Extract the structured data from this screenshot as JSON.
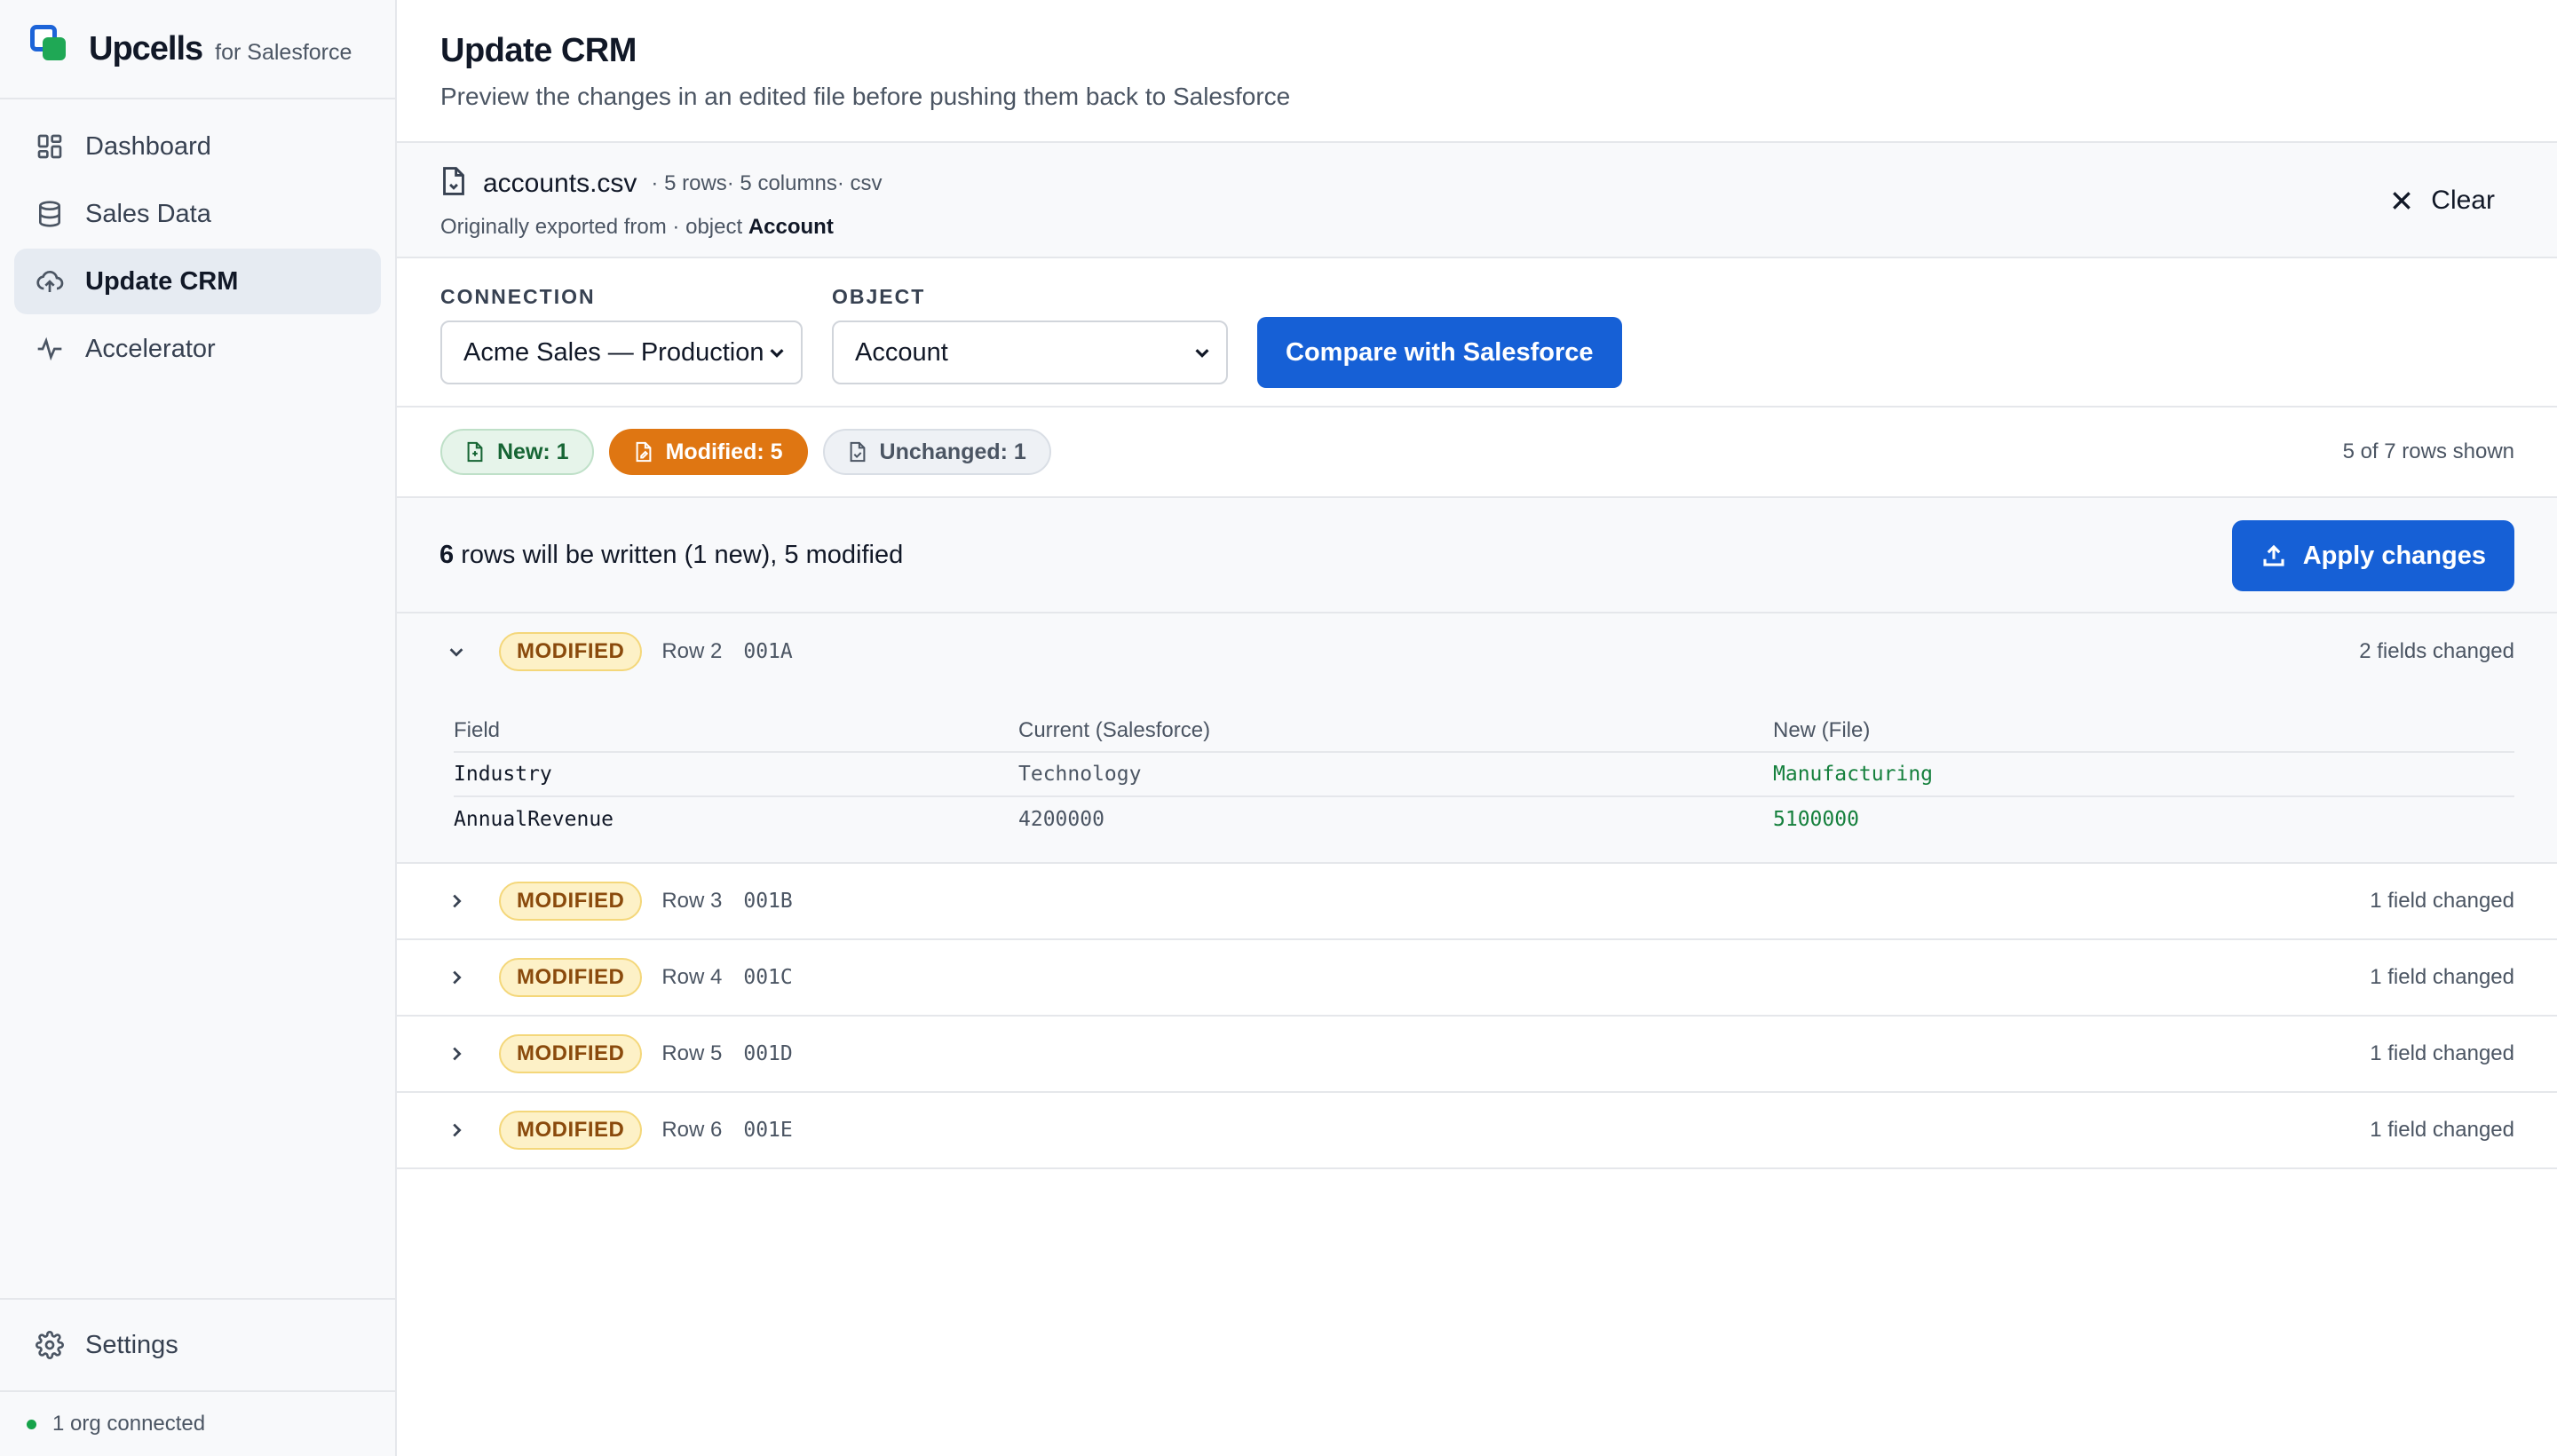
{
  "brand": {
    "name": "Upcells",
    "sub": "for Salesforce"
  },
  "sidebar": {
    "items": [
      {
        "label": "Dashboard",
        "icon": "grid-icon"
      },
      {
        "label": "Sales Data",
        "icon": "database-icon"
      },
      {
        "label": "Update CRM",
        "icon": "cloud-upload-icon",
        "active": true
      },
      {
        "label": "Accelerator",
        "icon": "activity-icon"
      }
    ],
    "settings_label": "Settings",
    "org_status": "1 org connected"
  },
  "header": {
    "title": "Update CRM",
    "subtitle": "Preview the changes in an edited file before pushing them back to Salesforce"
  },
  "file": {
    "name": "accounts.csv",
    "meta": "· 5 rows· 5 columns· csv",
    "origin_prefix": "Originally exported from · object",
    "origin_object": "Account",
    "clear_label": "Clear"
  },
  "selectors": {
    "connection_label": "CONNECTION",
    "connection_value": "Acme Sales — Production",
    "object_label": "OBJECT",
    "object_value": "Account",
    "compare_label": "Compare with Salesforce"
  },
  "filters": {
    "new": "New: 1",
    "modified": "Modified: 5",
    "unchanged": "Unchanged: 1",
    "rows_shown": "5 of 7 rows shown"
  },
  "summary": {
    "count": "6",
    "text": "rows will be written (1 new), 5 modified",
    "apply_label": "Apply changes"
  },
  "diff_headers": {
    "field": "Field",
    "current": "Current (Salesforce)",
    "new": "New (File)"
  },
  "rows": [
    {
      "badge": "MODIFIED",
      "row": "Row 2",
      "id": "001A",
      "changed": "2 fields changed",
      "expanded": true,
      "changes": [
        {
          "field": "Industry",
          "current": "Technology",
          "new": "Manufacturing"
        },
        {
          "field": "AnnualRevenue",
          "current": "4200000",
          "new": "5100000"
        }
      ]
    },
    {
      "badge": "MODIFIED",
      "row": "Row 3",
      "id": "001B",
      "changed": "1 field changed"
    },
    {
      "badge": "MODIFIED",
      "row": "Row 4",
      "id": "001C",
      "changed": "1 field changed"
    },
    {
      "badge": "MODIFIED",
      "row": "Row 5",
      "id": "001D",
      "changed": "1 field changed"
    },
    {
      "badge": "MODIFIED",
      "row": "Row 6",
      "id": "001E",
      "changed": "1 field changed"
    }
  ],
  "colors": {
    "primary": "#1660d6",
    "modified_chip": "#df7612",
    "badge_bg": "#fdf1c7",
    "new_value": "#15803d",
    "status_dot": "#16a34a"
  }
}
